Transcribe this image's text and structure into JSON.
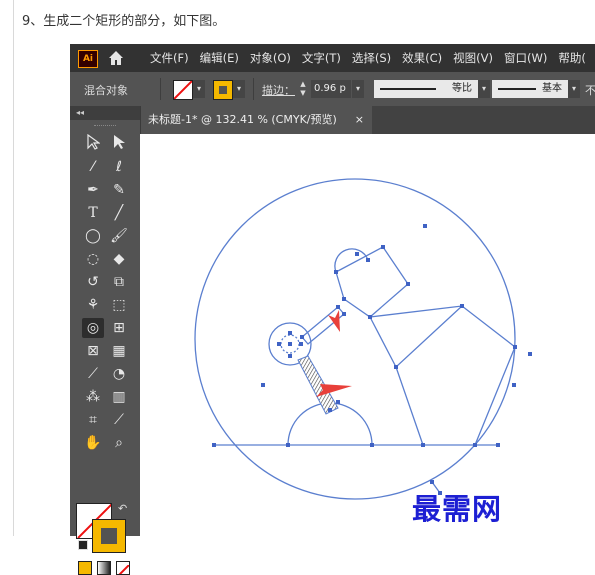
{
  "caption": "9、生成二个矩形的部分，如下图。",
  "app": {
    "logo": "Ai",
    "menu": [
      "文件(F)",
      "编辑(E)",
      "对象(O)",
      "文字(T)",
      "选择(S)",
      "效果(C)",
      "视图(V)",
      "窗口(W)",
      "帮助("
    ],
    "control_bar": {
      "selection_label": "混合对象",
      "stroke_label": "描边：",
      "stroke_value": "0.96 p",
      "profile_1": "等比",
      "profile_2": "基本",
      "trailing": "不"
    },
    "document_tab": {
      "title": "未标题-1* @ 132.41 % (CMYK/预览)",
      "close": "×"
    },
    "toolbar": {
      "collapse": "◂◂",
      "tools": [
        "selection-tool",
        "direct-selection-tool",
        "magic-wand-tool",
        "lasso-tool",
        "pen-tool",
        "curvature-tool",
        "type-tool",
        "line-tool",
        "ellipse-tool",
        "paintbrush-tool",
        "shaper-tool",
        "eraser-tool",
        "rotate-tool",
        "scale-tool",
        "warp-tool",
        "free-transform-tool",
        "shape-builder-tool",
        "perspective-grid-tool",
        "mesh-tool",
        "gradient-tool",
        "eyedropper-tool",
        "blend-tool",
        "symbol-sprayer-tool",
        "column-graph-tool",
        "artboard-tool",
        "slice-tool",
        "hand-tool",
        "zoom-tool"
      ],
      "active_tool": "shape-builder-tool"
    },
    "colors": {
      "accent_orange": "#ff9a00",
      "stroke_yellow": "#f5b800",
      "path_blue": "#5b7fcf",
      "arrow_red": "#e8403a"
    }
  },
  "watermark": "最需网"
}
